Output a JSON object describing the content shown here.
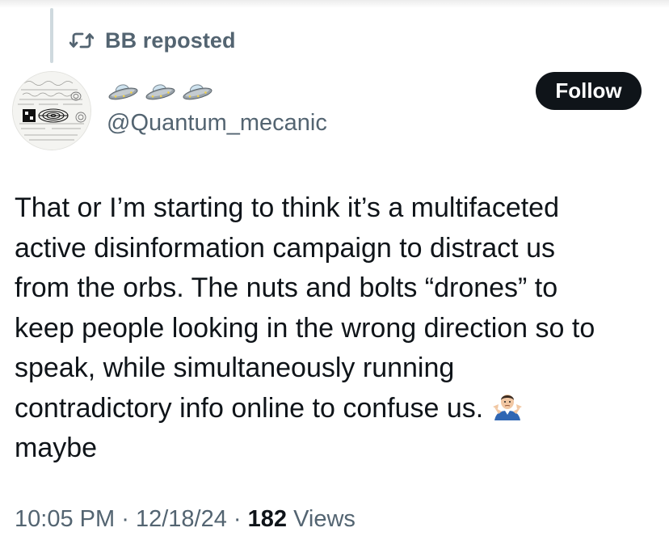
{
  "repost": {
    "icon": "repost-icon",
    "label": "BB reposted"
  },
  "author": {
    "avatar": "avatar-collage",
    "display_name_icons": [
      "flying-saucer-icon",
      "flying-saucer-icon",
      "flying-saucer-icon"
    ],
    "handle": "@Quantum_mecanic"
  },
  "follow_button": {
    "label": "Follow"
  },
  "tweet": {
    "lines": [
      "That or I’m starting to think it’s a multifaceted",
      "active disinformation campaign to distract us",
      "from the orbs. The nuts and bolts “drones” to",
      "keep people looking in the wrong direction so to",
      "speak, while simultaneously running",
      "contradictory info online to confuse us.",
      "maybe"
    ],
    "emoji": "person-shrugging-icon"
  },
  "meta": {
    "time": "10:05 PM",
    "separator": "·",
    "date": "12/18/24",
    "views_count": "182",
    "views_label": "Views"
  },
  "colors": {
    "text": "#0f1419",
    "secondary": "#536471",
    "button_bg": "#0f1419",
    "button_text": "#ffffff",
    "thread_line": "#cfd9de"
  }
}
